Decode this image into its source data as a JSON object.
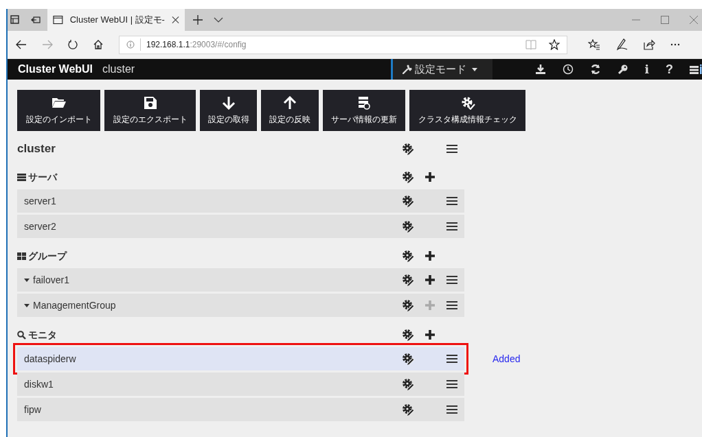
{
  "browser": {
    "tabs": [
      {
        "title": "Cluster WebUI | 設定モ-",
        "selected": true
      }
    ],
    "address_host": "192.168.1.1",
    "address_path": ":29003/#/config"
  },
  "app_header": {
    "brand": "Cluster WebUI",
    "cluster_name": "cluster",
    "mode": "設定モード",
    "info_label": "i",
    "help_label": "?"
  },
  "toolbar": [
    {
      "kind": "import",
      "label": "設定のインポート"
    },
    {
      "kind": "export",
      "label": "設定のエクスポート"
    },
    {
      "kind": "get",
      "label": "設定の取得"
    },
    {
      "kind": "apply",
      "label": "設定の反映"
    },
    {
      "kind": "server_update",
      "label": "サーバ情報の更新"
    },
    {
      "kind": "check",
      "label": "クラスタ構成情報チェック"
    }
  ],
  "cluster": {
    "title": "cluster"
  },
  "sections": [
    {
      "kind": "server",
      "title": "サーバ",
      "rows": [
        {
          "name": "server1",
          "highlighted": false
        },
        {
          "name": "server2",
          "highlighted": false
        }
      ]
    },
    {
      "kind": "group",
      "title": "グループ",
      "rows": [
        {
          "name": "failover1",
          "expanded": true,
          "add_enabled": true,
          "highlighted": false
        },
        {
          "name": "ManagementGroup",
          "expanded": true,
          "add_enabled": false,
          "highlighted": false
        }
      ]
    },
    {
      "kind": "monitor",
      "title": "モニタ",
      "rows": [
        {
          "name": "dataspiderw",
          "highlighted": true,
          "status": "Added"
        },
        {
          "name": "diskw1",
          "highlighted": false
        },
        {
          "name": "fipw",
          "highlighted": false
        }
      ]
    }
  ]
}
